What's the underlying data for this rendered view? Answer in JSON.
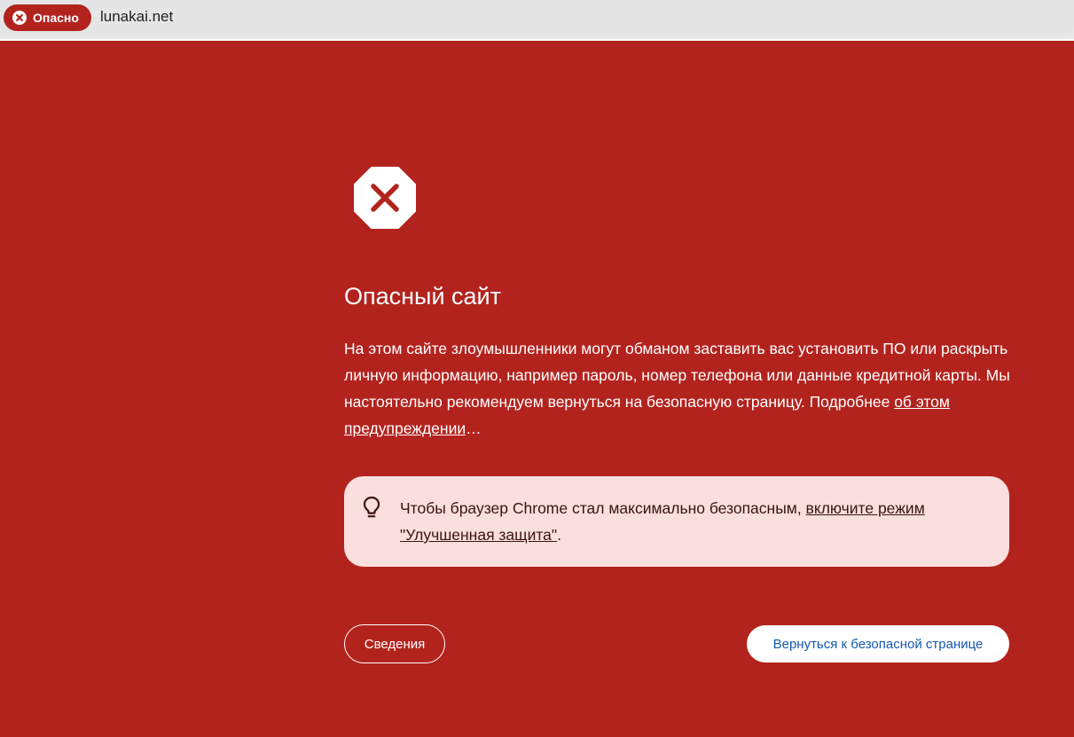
{
  "address_bar": {
    "security_chip_label": "Опасно",
    "url": "lunakai.net"
  },
  "interstitial": {
    "title": "Опасный сайт",
    "body_text": "На этом сайте злоумышленники могут обманом заставить вас установить ПО или раскрыть личную информацию, например пароль, номер телефона или данные кредитной карты. Мы настоятельно рекомендуем вернуться на безопасную страницу. Подробнее ",
    "learn_more_link": "об этом предупреждении",
    "learn_more_suffix": "…",
    "tip": {
      "text": "Чтобы браузер Chrome стал максимально безопасным, ",
      "link": "включите режим \"Улучшенная защита\"",
      "suffix": "."
    },
    "details_button": "Сведения",
    "back_button": "Вернуться к безопасной странице"
  },
  "icons": {
    "chip_icon": "error-circle-icon",
    "main_icon": "stop-sign-icon",
    "tip_icon": "lightbulb-icon"
  },
  "colors": {
    "danger_background": "#b3231e",
    "tip_background": "#f9dfdd",
    "link_blue": "#1558b0"
  }
}
